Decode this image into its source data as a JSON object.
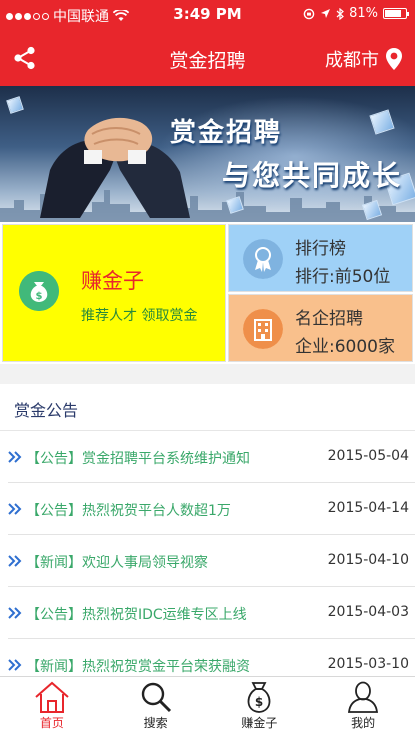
{
  "status_bar": {
    "carrier": "中国联通",
    "time": "3:49 PM",
    "battery": "81%",
    "battery_level": 0.81
  },
  "nav": {
    "title": "赏金招聘",
    "city": "成都市"
  },
  "banner": {
    "line1": "赏金招聘",
    "line2": "与您共同成长"
  },
  "features": {
    "earn": {
      "title": "赚金子",
      "subtitle": "推荐人才 领取赏金"
    },
    "rank": {
      "title": "排行榜",
      "subtitle": "排行:前50位"
    },
    "corp": {
      "title": "名企招聘",
      "subtitle": "企业:6000家"
    }
  },
  "announcements": {
    "title": "赏金公告",
    "items": [
      {
        "text": "【公告】赏金招聘平台系统维护通知",
        "date": "2015-05-04"
      },
      {
        "text": "【公告】热烈祝贺平台人数超1万",
        "date": "2015-04-14"
      },
      {
        "text": "【新闻】欢迎人事局领导视察",
        "date": "2015-04-10"
      },
      {
        "text": "【公告】热烈祝贺IDC运维专区上线",
        "date": "2015-04-03"
      },
      {
        "text": "【新闻】热烈祝贺赏金平台荣获融资",
        "date": "2015-03-10"
      }
    ]
  },
  "tabs": [
    {
      "label": "首页",
      "icon": "home-icon",
      "active": true
    },
    {
      "label": "搜索",
      "icon": "search-icon",
      "active": false
    },
    {
      "label": "赚金子",
      "icon": "money-bag-icon",
      "active": false
    },
    {
      "label": "我的",
      "icon": "profile-icon",
      "active": false
    }
  ],
  "colors": {
    "brand_red": "#e8262c",
    "earn_yellow": "#ffff00",
    "rank_blue": "#9fd1f7",
    "corp_orange": "#f9c08c",
    "news_green": "#3aa86a"
  }
}
